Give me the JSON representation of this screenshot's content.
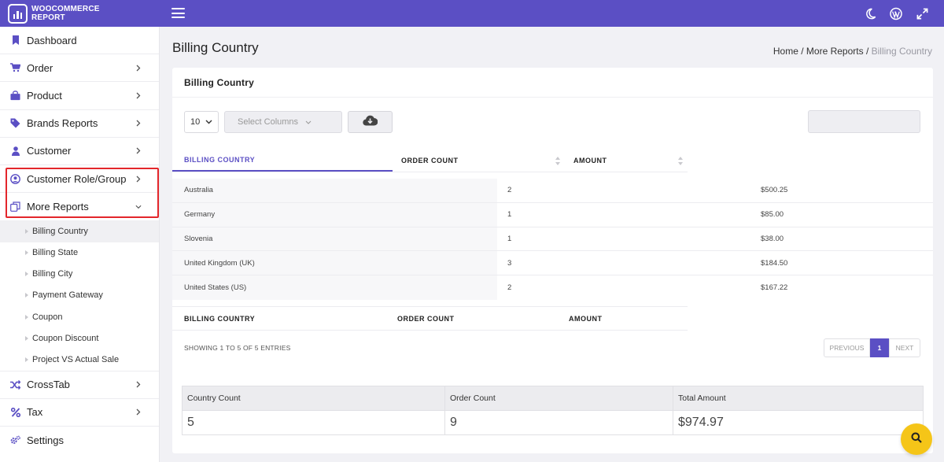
{
  "brand": {
    "line1": "WOOCOMMERCE",
    "line2": "REPORT"
  },
  "colors": {
    "primary": "#5b4fc4",
    "accent": "#f5c518",
    "highlight": "#e3262b"
  },
  "topbar_icons": [
    "menu-icon",
    "moon-icon",
    "wordpress-icon",
    "expand-icon"
  ],
  "sidebar": {
    "items": [
      {
        "label": "Dashboard",
        "icon": "bookmark-icon"
      },
      {
        "label": "Order",
        "icon": "cart-icon"
      },
      {
        "label": "Product",
        "icon": "bag-icon"
      },
      {
        "label": "Brands Reports",
        "icon": "tag-icon"
      },
      {
        "label": "Customer",
        "icon": "user-icon"
      },
      {
        "label": "Customer Role/Group",
        "icon": "user-circle-icon"
      },
      {
        "label": "More Reports",
        "icon": "copy-icon"
      },
      {
        "label": "CrossTab",
        "icon": "shuffle-icon"
      },
      {
        "label": "Tax",
        "icon": "percent-icon"
      },
      {
        "label": "Settings",
        "icon": "gears-icon"
      }
    ],
    "sub_items": [
      "Billing Country",
      "Billing State",
      "Billing City",
      "Payment Gateway",
      "Coupon",
      "Coupon Discount",
      "Project VS Actual Sale"
    ]
  },
  "page": {
    "title": "Billing Country",
    "breadcrumb": {
      "home": "Home",
      "sep": " / ",
      "section": "More Reports",
      "current": "Billing Country"
    }
  },
  "card": {
    "title": "Billing Country",
    "page_length": "10",
    "select_columns_placeholder": "Select Columns",
    "search_value": ""
  },
  "table": {
    "headers": [
      "BILLING COUNTRY",
      "ORDER COUNT",
      "AMOUNT"
    ],
    "rows": [
      {
        "country": "Australia",
        "count": "2",
        "amount": "$500.25"
      },
      {
        "country": "Germany",
        "count": "1",
        "amount": "$85.00"
      },
      {
        "country": "Slovenia",
        "count": "1",
        "amount": "$38.00"
      },
      {
        "country": "United Kingdom (UK)",
        "count": "3",
        "amount": "$184.50"
      },
      {
        "country": "United States (US)",
        "count": "2",
        "amount": "$167.22"
      }
    ],
    "footers": [
      "BILLING COUNTRY",
      "ORDER COUNT",
      "AMOUNT"
    ],
    "info": "SHOWING 1 TO 5 OF 5 ENTRIES",
    "pagination": {
      "prev": "PREVIOUS",
      "page": "1",
      "next": "NEXT"
    }
  },
  "summary": {
    "headers": [
      "Country Count",
      "Order Count",
      "Total Amount"
    ],
    "values": [
      "5",
      "9",
      "$974.97"
    ]
  }
}
